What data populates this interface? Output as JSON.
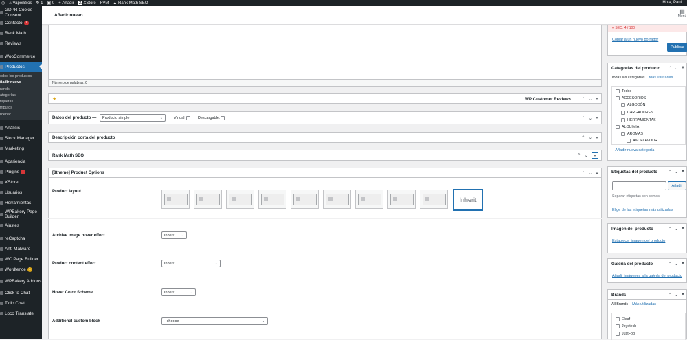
{
  "admin_bar": {
    "site_name": "VaporBros",
    "updates_count": "1",
    "comments_count": "0",
    "new_label": "Añadir",
    "xstore_label": "XStore",
    "fvm_label": "FVM",
    "rankmath_label": "Rank Math SEO",
    "greeting": "Hola, Paul"
  },
  "sidebar": {
    "items": [
      {
        "label": "GDPR Cookie Consent"
      },
      {
        "label": "Contacto",
        "badge": "1"
      },
      {
        "label": "Rank Math"
      },
      {
        "label": "Reviews"
      },
      {
        "label": "WooCommerce"
      },
      {
        "label": "Productos"
      },
      {
        "label": "Análisis"
      },
      {
        "label": "Stock Manager"
      },
      {
        "label": "Marketing"
      },
      {
        "label": "Apariencia"
      },
      {
        "label": "Plugins",
        "badge": "1"
      },
      {
        "label": "XStore"
      },
      {
        "label": "Usuarios"
      },
      {
        "label": "Herramientas"
      },
      {
        "label": "WPBakery Page Builder"
      },
      {
        "label": "Ajustes"
      },
      {
        "label": "reCaptcha"
      },
      {
        "label": "Anti-Malware"
      },
      {
        "label": "WC Page Builder"
      },
      {
        "label": "Wordfence",
        "badge": "1"
      },
      {
        "label": "WPBakery Addons"
      },
      {
        "label": "Click to Chat"
      },
      {
        "label": "Tidio Chat"
      },
      {
        "label": "Loco Translate"
      }
    ],
    "submenu": [
      "odos los productos",
      "ñadir nuevo",
      "rands",
      "ategorías",
      "tiquetas",
      "tributos",
      "rdenar"
    ]
  },
  "header": {
    "title": "Añadir nuevo",
    "menu_label": "Menú"
  },
  "editor": {
    "word_count": "Número de palabras: 0"
  },
  "boxes": {
    "reviews_title": "WP Customer Reviews",
    "product_data_label": "Datos del producto —",
    "product_type": "Producto simple",
    "virtual_label": "Virtual:",
    "downloadable_label": "Descargable:",
    "short_desc_title": "Descripción corta del producto",
    "rankmath_title": "Rank Math SEO",
    "options_title": "[8theme] Product Options"
  },
  "options": {
    "product_layout_label": "Product layout",
    "inherit_label": "Inherit",
    "archive_hover_label": "Archive image hover effect",
    "archive_hover_value": "Inherit",
    "content_effect_label": "Product content effect",
    "content_effect_value": "Inherit",
    "hover_color_label": "Hover Color Scheme",
    "hover_color_value": "Inherit",
    "custom_block_label": "Additional custom block",
    "custom_block_value": "--choose--"
  },
  "publish": {
    "seo_score": "SEO: 4 / 100",
    "copy_draft_link": "Copiar a un nuevo borrador",
    "publish_button": "Publicar"
  },
  "categories": {
    "title": "Categorías del producto",
    "tab_all": "Todas las categorías",
    "tab_most_used": "Más utilizadas",
    "items": [
      {
        "label": "Todos"
      },
      {
        "label": "ACCESORIOS"
      },
      {
        "label": "ALGODÓN"
      },
      {
        "label": "CARGADORES"
      },
      {
        "label": "HERRAMIENTAS"
      },
      {
        "label": "ALQUIMIA"
      },
      {
        "label": "AROMAS"
      },
      {
        "label": "A&L FLAVOUR"
      }
    ],
    "add_new_link": "+ Añadir nueva categoría"
  },
  "tags": {
    "title": "Etiquetas del producto",
    "add_button": "Añadir",
    "help": "Separar etiquetas con comas",
    "most_used_link": "Elige de las etiquetas más utilizadas"
  },
  "product_image": {
    "title": "Imagen del producto",
    "set_link": "Establecer imagen del producto"
  },
  "gallery": {
    "title": "Galería del producto",
    "add_link": "Añadir imágenes a la galería del producto"
  },
  "brands": {
    "title": "Brands",
    "tab_all": "All Brands",
    "tab_most_used": "Más utilizadas",
    "items": [
      {
        "label": "Eleaf"
      },
      {
        "label": "Joyetech"
      },
      {
        "label": "JustFog"
      }
    ]
  }
}
